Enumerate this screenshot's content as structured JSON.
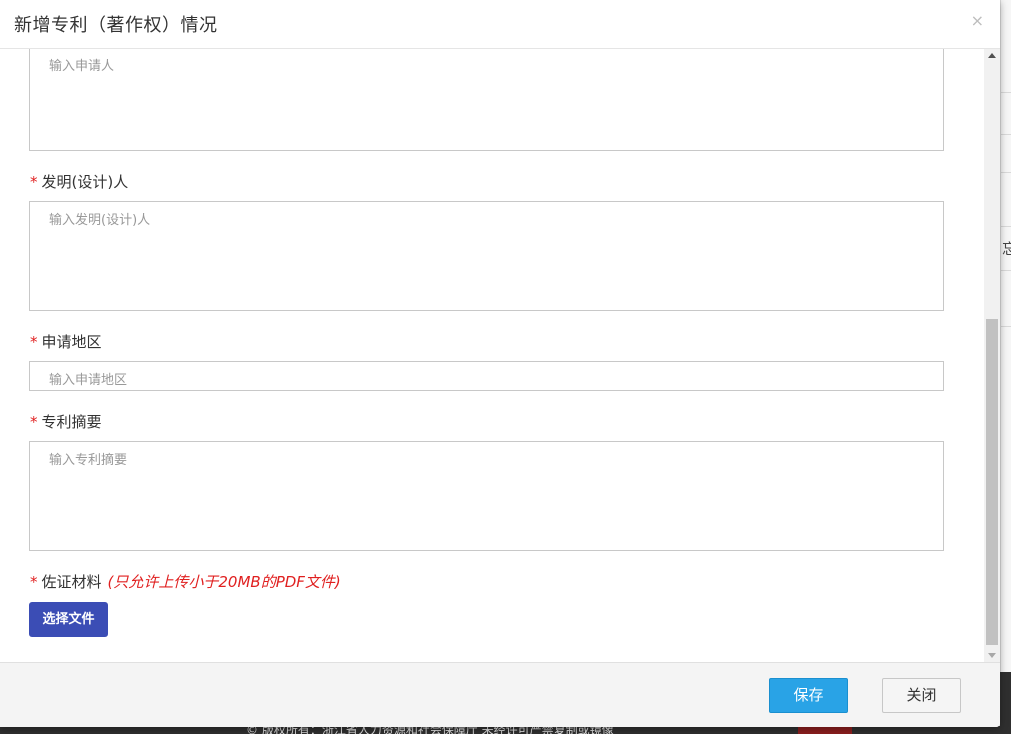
{
  "modal": {
    "title": "新增专利（著作权）情况",
    "close_glyph": "×"
  },
  "fields": {
    "applicant": {
      "placeholder": "输入申请人"
    },
    "inventor": {
      "required_mark": "*",
      "label": "发明(设计)人",
      "placeholder": "输入发明(设计)人"
    },
    "region": {
      "required_mark": "*",
      "label": "申请地区",
      "placeholder": "输入申请地区"
    },
    "abstract": {
      "required_mark": "*",
      "label": "专利摘要",
      "placeholder": "输入专利摘要"
    },
    "evidence": {
      "required_mark": "*",
      "label": "佐证材料",
      "hint": "(只允许上传小于20MB的PDF文件)",
      "button_label": "选择文件"
    }
  },
  "footer": {
    "save_label": "保存",
    "close_label": "关闭"
  },
  "background": {
    "side_glyph": "忘",
    "footer_text": "© 版权所有：浙江省人力资源和社会保障厅  未经许可严禁复制或镜像"
  },
  "colors": {
    "required": "#e02020",
    "primary_button": "#3b4db5",
    "save_button": "#29a3e6"
  }
}
